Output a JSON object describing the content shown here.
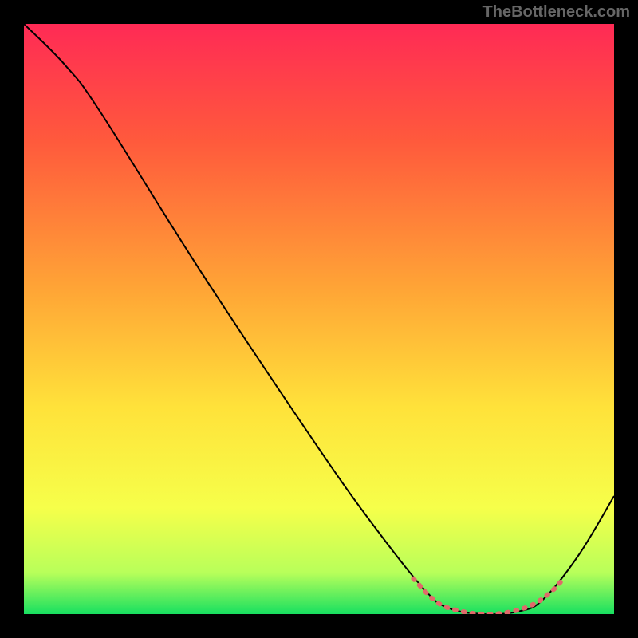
{
  "watermark": "TheBottleneck.com",
  "chart_data": {
    "type": "line",
    "title": "",
    "xlabel": "",
    "ylabel": "",
    "xlim": [
      0,
      100
    ],
    "ylim": [
      0,
      100
    ],
    "gradient_stops": [
      {
        "offset": 0,
        "color": "#ff2a55"
      },
      {
        "offset": 20,
        "color": "#ff5a3c"
      },
      {
        "offset": 45,
        "color": "#ffa536"
      },
      {
        "offset": 65,
        "color": "#ffe23a"
      },
      {
        "offset": 82,
        "color": "#f6ff4a"
      },
      {
        "offset": 93,
        "color": "#b8ff5a"
      },
      {
        "offset": 100,
        "color": "#18e060"
      }
    ],
    "series": [
      {
        "name": "curve",
        "color": "#000000",
        "width": 2,
        "points": [
          {
            "x": 0,
            "y": 100
          },
          {
            "x": 7,
            "y": 93
          },
          {
            "x": 13,
            "y": 85
          },
          {
            "x": 30,
            "y": 58
          },
          {
            "x": 50,
            "y": 28
          },
          {
            "x": 60,
            "y": 14
          },
          {
            "x": 68,
            "y": 4
          },
          {
            "x": 72,
            "y": 1
          },
          {
            "x": 78,
            "y": 0
          },
          {
            "x": 84,
            "y": 0.5
          },
          {
            "x": 88,
            "y": 2.5
          },
          {
            "x": 94,
            "y": 10
          },
          {
            "x": 100,
            "y": 20
          }
        ]
      },
      {
        "name": "highlight",
        "color": "#e06a6a",
        "width": 6,
        "points": [
          {
            "x": 66,
            "y": 6
          },
          {
            "x": 70,
            "y": 2
          },
          {
            "x": 74,
            "y": 0.5
          },
          {
            "x": 78,
            "y": 0
          },
          {
            "x": 82,
            "y": 0.3
          },
          {
            "x": 86,
            "y": 1.5
          },
          {
            "x": 89,
            "y": 3.5
          },
          {
            "x": 91,
            "y": 5.5
          }
        ]
      }
    ]
  }
}
